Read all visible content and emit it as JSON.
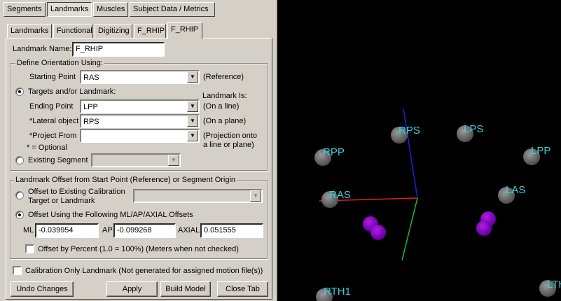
{
  "top_tabs": [
    "Segments",
    "Landmarks",
    "Muscles",
    "Subject Data / Metrics"
  ],
  "sub_tabs": [
    "Landmarks",
    "Functional",
    "Digitizing",
    "F_RHIP",
    "F_RHIP"
  ],
  "landmark_name": {
    "label": "Landmark Name:",
    "value": "F_RHIP"
  },
  "orientation": {
    "legend": "Define Orientation Using:",
    "starting_point_label": "Starting Point",
    "starting_point_value": "RAS",
    "starting_point_note": "(Reference)",
    "targets_label": "Targets and/or Landmark:",
    "landmark_is_label": "Landmark Is:",
    "ending_point_label": "Ending Point",
    "ending_point_value": "LPP",
    "ending_point_note": "(On a line)",
    "lateral_label": "*Lateral object",
    "lateral_value": "RPS",
    "lateral_note": "(On a plane)",
    "project_label": "*Project From",
    "project_value": "",
    "project_note_1": "(Projection onto",
    "project_note_2": "a line or plane)",
    "optional_note": "* = Optional",
    "existing_segment_label": "Existing Segment"
  },
  "offset": {
    "legend": "Landmark Offset from Start Point (Reference) or Segment Origin",
    "calib_label_1": "Offset to Existing Calibration",
    "calib_label_2": "Target or Landmark",
    "mlap_label": "Offset Using the Following ML/AP/AXIAL Offsets",
    "ml_label": "ML",
    "ml_value": "-0.039954",
    "ap_label": "AP",
    "ap_value": "-0.099268",
    "axial_label": "AXIAL",
    "axial_value": "0.051555",
    "percent_label": "Offset by Percent (1.0 = 100%) (Meters when not checked)"
  },
  "calibration_only_label": "Calibration Only Landmark (Not generated for assigned motion file(s))",
  "buttons": {
    "undo": "Undo Changes",
    "apply": "Apply",
    "build": "Build Model",
    "close": "Close Tab"
  },
  "viewport_markers": [
    "RPS",
    "LPS",
    "RPP",
    "LPP",
    "RAS",
    "LAS",
    "RTH1",
    "LTH"
  ],
  "colors": {
    "marker_label": "#3bd0e0",
    "virtual_marker": "#7000b0",
    "axis_x": "#e02020",
    "axis_y": "#20c020",
    "axis_z": "#2020e0"
  }
}
